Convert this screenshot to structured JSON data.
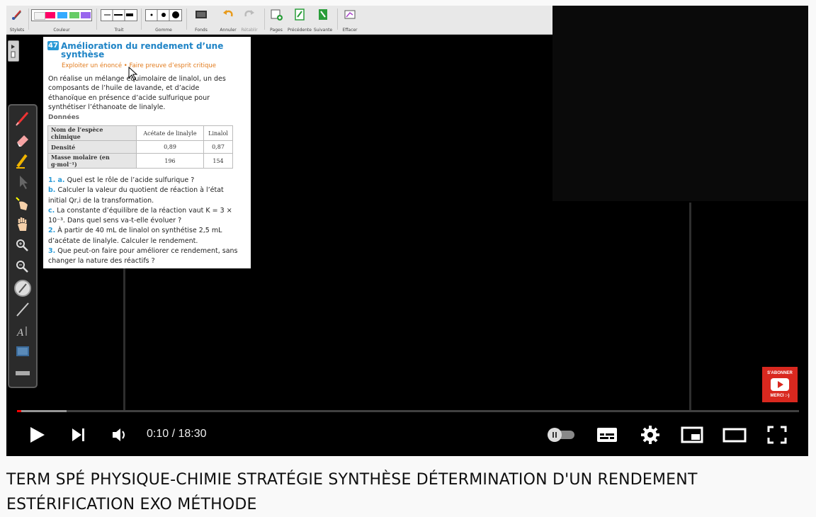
{
  "toolbar": {
    "stylets": "Stylets",
    "couleur": "Couleur",
    "trait": "Trait",
    "gomme": "Gomme",
    "fonds": "Fonds",
    "annuler": "Annuler",
    "retablir": "Rétablir",
    "pages": "Pages",
    "precedente": "Précédente",
    "suivante": "Suivante",
    "effacer": "Effacer"
  },
  "document": {
    "number": "47",
    "title": "Amélioration du rendement d’une synthèse",
    "subtitle": "Exploiter un énoncé • Faire preuve d’esprit critique",
    "intro": "On réalise un mélange équimolaire de linalol, un des composants de l’huile de lavande, et d’acide éthanoïque en présence d’acide sulfurique pour synthétiser l’éthanoate de linalyle.",
    "donnees": "Données",
    "table": {
      "headers": [
        "Nom de l’espèce chimique",
        "Acétate de linalyle",
        "Linalol"
      ],
      "rows": [
        [
          "Densité",
          "0,89",
          "0,87"
        ],
        [
          "Masse molaire (en g·mol⁻¹)",
          "196",
          "154"
        ]
      ]
    },
    "questions": [
      {
        "num": "1. a.",
        "text": "Quel est le rôle de l’acide sulfurique ?"
      },
      {
        "num": "b.",
        "text": "Calculer la valeur du quotient de réaction à l’état initial Qr,i de la transformation."
      },
      {
        "num": "c.",
        "text": "La constante d’équilibre de la réaction vaut K = 3 × 10⁻³. Dans quel sens va-t-elle évoluer ?"
      },
      {
        "num": "2.",
        "text": "À partir de 40 mL de linalol on synthétise 2,5 mL d’acétate de linalyle. Calculer le rendement."
      },
      {
        "num": "3.",
        "text": "Que peut-on faire pour améliorer ce rendement, sans changer la nature des réactifs ?"
      }
    ]
  },
  "subscribe": {
    "line1": "S'ABONNER",
    "line2": "MERCI :-)"
  },
  "player": {
    "time": "0:10 / 18:30",
    "played_fraction": 0.0055,
    "loaded_fraction": 0.063
  },
  "video_title": "TERM SPÉ PHYSIQUE-CHIMIE STRATÉGIE SYNTHÈSE DÉTERMINATION D'UN RENDEMENT ESTÉRIFICATION EXO MÉTHODE",
  "colors": {
    "accent": "#ff0000",
    "doc_title": "#1f84c6",
    "doc_subtitle": "#e27b1c"
  }
}
